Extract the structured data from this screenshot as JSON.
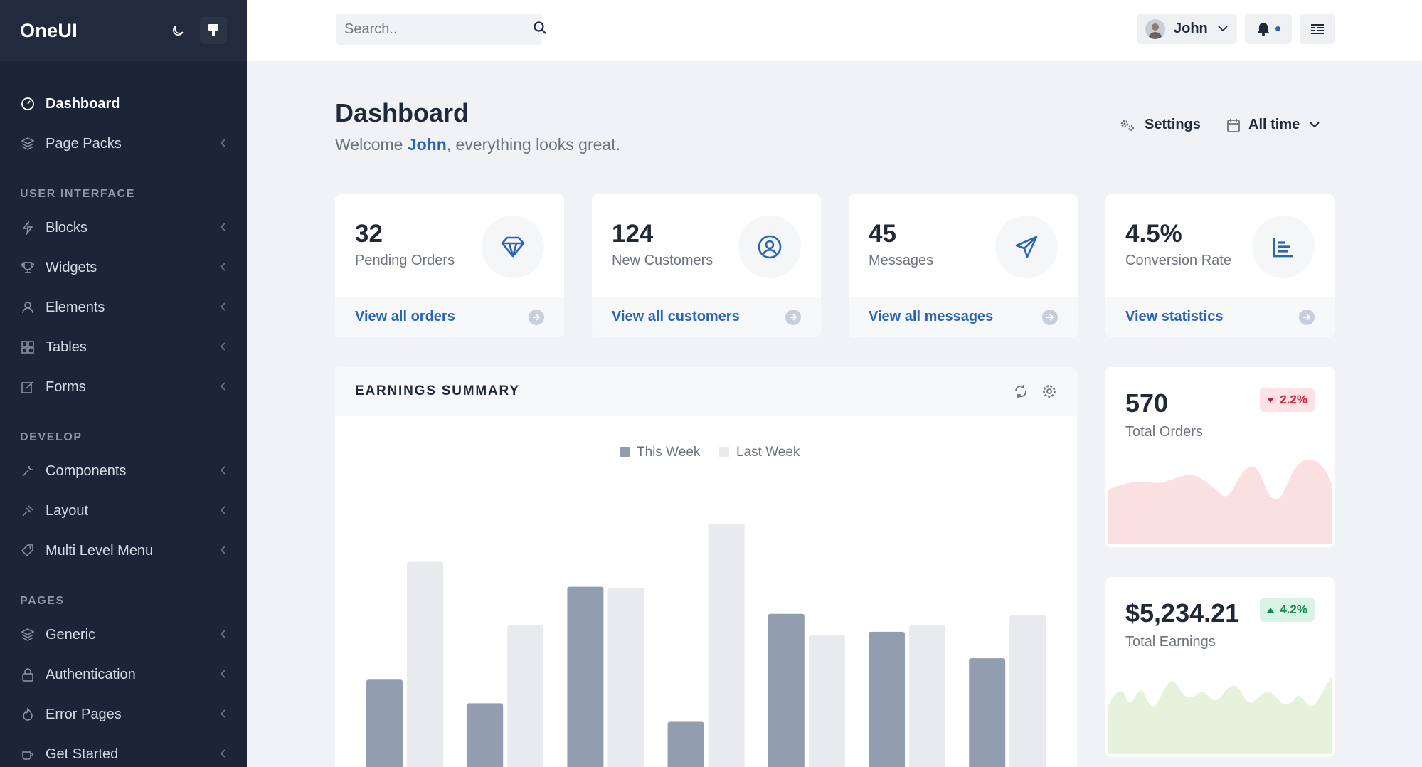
{
  "sidebar": {
    "brand": "OneUI",
    "nav": [
      {
        "label": "Dashboard",
        "icon": "dashboard-icon",
        "active": true
      },
      {
        "label": "Page Packs",
        "icon": "layers-icon"
      }
    ],
    "sections": [
      {
        "heading": "USER INTERFACE",
        "items": [
          "Blocks",
          "Widgets",
          "Elements",
          "Tables",
          "Forms"
        ]
      },
      {
        "heading": "DEVELOP",
        "items": [
          "Components",
          "Layout",
          "Multi Level Menu"
        ]
      },
      {
        "heading": "PAGES",
        "items": [
          "Generic",
          "Authentication",
          "Error Pages",
          "Get Started"
        ]
      }
    ]
  },
  "header": {
    "search_placeholder": "Search..",
    "user_name": "John"
  },
  "page": {
    "title": "Dashboard",
    "welcome_prefix": "Welcome ",
    "welcome_name": "John",
    "welcome_suffix": ", everything looks great.",
    "settings_label": "Settings",
    "period_label": "All time"
  },
  "stats": [
    {
      "value": "32",
      "label": "Pending Orders",
      "link": "View all orders",
      "icon": "diamond-icon"
    },
    {
      "value": "124",
      "label": "New Customers",
      "link": "View all customers",
      "icon": "user-circle-icon"
    },
    {
      "value": "45",
      "label": "Messages",
      "link": "View all messages",
      "icon": "paper-plane-icon"
    },
    {
      "value": "4.5%",
      "label": "Conversion Rate",
      "link": "View statistics",
      "icon": "bar-chart-icon"
    }
  ],
  "earnings": {
    "title": "EARNINGS SUMMARY"
  },
  "chart_data": {
    "type": "bar",
    "title": "",
    "series": [
      {
        "name": "This Week",
        "color": "#929eb0",
        "values": [
          160,
          127,
          290,
          101,
          252,
          227,
          190
        ]
      },
      {
        "name": "Last Week",
        "color": "#e8eaed",
        "values": [
          325,
          236,
          288,
          378,
          222,
          236,
          250
        ]
      }
    ],
    "ylim": [
      0,
      420
    ],
    "legend": "top-center",
    "grid": false
  },
  "widgets": [
    {
      "value": "570",
      "label": "Total Orders",
      "badge": "2.2%",
      "trend": "down",
      "fill": "#fbe0e1"
    },
    {
      "value": "$5,234.21",
      "label": "Total Earnings",
      "badge": "4.2%",
      "trend": "up",
      "fill": "#e6f2dc"
    }
  ],
  "colors": {
    "accent": "#2a64b8",
    "sidebar": "#1c2537",
    "bar_this": "#929eb0",
    "bar_last": "#e8eaed"
  }
}
